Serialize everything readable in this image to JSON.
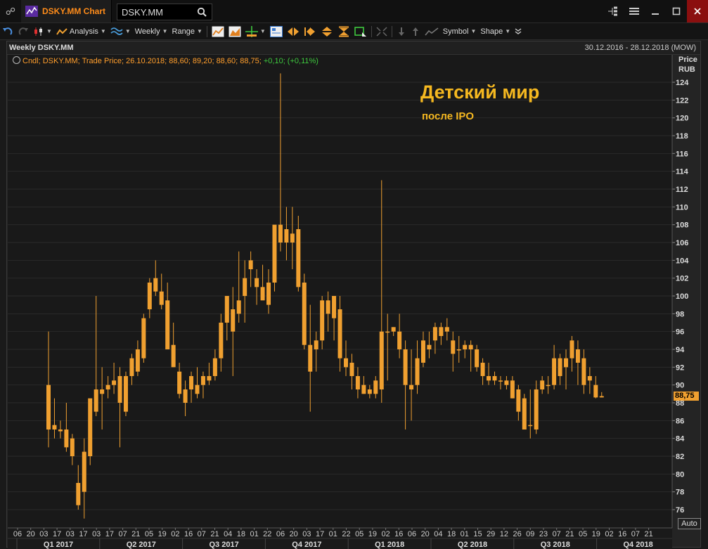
{
  "app": {
    "title": "DSKY.MM Chart",
    "symbol_value": "DSKY.MM"
  },
  "toolbar": {
    "analysis_label": "Analysis",
    "period_label": "Weekly",
    "range_label": "Range",
    "symbol_label": "Symbol",
    "shape_label": "Shape"
  },
  "chart_header": {
    "name": "Weekly DSKY.MM",
    "date_range": "30.12.2016 - 28.12.2018 (MOW)"
  },
  "legend": {
    "text": "Cndl; DSKY.MM; Trade Price; 26.10.2018; 88,60; 89,20; 88,60; 88,75;",
    "change": "+0,10; (+0,11%)"
  },
  "annotation": {
    "title": "Детский мир",
    "subtitle": "после IPO"
  },
  "price_axis": {
    "title_line1": "Price",
    "title_line2": "RUB",
    "last_price": "88,75",
    "auto_label": "Auto"
  },
  "colors": {
    "candle": "#f0a030",
    "accent": "#ff8c1a",
    "annotation": "#f5b820",
    "change_positive": "#3ec93e"
  },
  "chart_data": {
    "type": "candlestick",
    "period": "weekly",
    "ylim": [
      74,
      126
    ],
    "y_ticks": [
      76,
      78,
      80,
      82,
      84,
      86,
      88,
      90,
      92,
      94,
      96,
      98,
      100,
      102,
      104,
      106,
      108,
      110,
      112,
      114,
      116,
      118,
      120,
      122,
      124
    ],
    "x_day_labels": [
      "06",
      "20",
      "03",
      "17",
      "03",
      "17",
      "03",
      "17",
      "07",
      "21",
      "05",
      "19",
      "02",
      "16",
      "07",
      "21",
      "04",
      "18",
      "01",
      "22",
      "06",
      "20",
      "03",
      "17",
      "01",
      "22",
      "05",
      "19",
      "02",
      "16",
      "06",
      "20",
      "04",
      "18",
      "01",
      "15",
      "29",
      "12",
      "26",
      "09",
      "23",
      "07",
      "21",
      "05",
      "19",
      "02",
      "16",
      "07",
      "21"
    ],
    "quarter_labels": [
      "Q1 2017",
      "Q2 2017",
      "Q3 2017",
      "Q4 2017",
      "Q1 2018",
      "Q2 2018",
      "Q3 2018",
      "Q4 2018"
    ],
    "candles": [
      {
        "o": 85.0,
        "h": 96.0,
        "l": 83.0,
        "c": 90.0
      },
      {
        "o": 85.0,
        "h": 88.5,
        "l": 84.0,
        "c": 85.5
      },
      {
        "o": 85.0,
        "h": 86.0,
        "l": 84.0,
        "c": 84.8
      },
      {
        "o": 83.0,
        "h": 88.0,
        "l": 82.5,
        "c": 85.0
      },
      {
        "o": 84.0,
        "h": 84.5,
        "l": 81.0,
        "c": 82.0
      },
      {
        "o": 79.0,
        "h": 81.0,
        "l": 76.0,
        "c": 76.5
      },
      {
        "o": 78.0,
        "h": 84.0,
        "l": 75.0,
        "c": 82.5
      },
      {
        "o": 82.0,
        "h": 85.0,
        "l": 81.0,
        "c": 88.5
      },
      {
        "o": 87.0,
        "h": 100.0,
        "l": 86.5,
        "c": 89.5
      },
      {
        "o": 89.0,
        "h": 92.0,
        "l": 85.0,
        "c": 89.5
      },
      {
        "o": 89.5,
        "h": 91.0,
        "l": 88.5,
        "c": 90.0
      },
      {
        "o": 90.0,
        "h": 92.5,
        "l": 89.0,
        "c": 90.5
      },
      {
        "o": 91.0,
        "h": 92.0,
        "l": 83.0,
        "c": 88.0
      },
      {
        "o": 87.0,
        "h": 91.5,
        "l": 86.5,
        "c": 91.0
      },
      {
        "o": 91.0,
        "h": 93.5,
        "l": 90.0,
        "c": 93.0
      },
      {
        "o": 94.0,
        "h": 95.0,
        "l": 91.0,
        "c": 91.5
      },
      {
        "o": 93.0,
        "h": 98.0,
        "l": 92.5,
        "c": 97.5
      },
      {
        "o": 98.5,
        "h": 102.0,
        "l": 97.5,
        "c": 101.5
      },
      {
        "o": 102.0,
        "h": 104.0,
        "l": 100.0,
        "c": 100.5
      },
      {
        "o": 100.5,
        "h": 102.5,
        "l": 98.5,
        "c": 99.0
      },
      {
        "o": 99.5,
        "h": 101.5,
        "l": 97.0,
        "c": 94.0
      },
      {
        "o": 94.5,
        "h": 97.0,
        "l": 92.0,
        "c": 92.0
      },
      {
        "o": 91.5,
        "h": 92.5,
        "l": 88.5,
        "c": 89.0
      },
      {
        "o": 89.5,
        "h": 90.5,
        "l": 86.5,
        "c": 88.0
      },
      {
        "o": 89.5,
        "h": 91.5,
        "l": 88.0,
        "c": 91.0
      },
      {
        "o": 89.0,
        "h": 92.0,
        "l": 88.5,
        "c": 90.0
      },
      {
        "o": 90.0,
        "h": 91.5,
        "l": 88.5,
        "c": 91.0
      },
      {
        "o": 90.5,
        "h": 92.5,
        "l": 90.0,
        "c": 91.0
      },
      {
        "o": 91.0,
        "h": 94.0,
        "l": 90.5,
        "c": 93.0
      },
      {
        "o": 93.0,
        "h": 98.0,
        "l": 91.5,
        "c": 97.0
      },
      {
        "o": 97.0,
        "h": 100.0,
        "l": 95.0,
        "c": 100.0
      },
      {
        "o": 96.0,
        "h": 101.0,
        "l": 91.0,
        "c": 98.5
      },
      {
        "o": 98.0,
        "h": 105.0,
        "l": 97.0,
        "c": 99.5
      },
      {
        "o": 100.0,
        "h": 104.0,
        "l": 97.0,
        "c": 102.0
      },
      {
        "o": 103.0,
        "h": 105.0,
        "l": 101.0,
        "c": 104.0
      },
      {
        "o": 102.0,
        "h": 103.0,
        "l": 99.0,
        "c": 101.0
      },
      {
        "o": 101.0,
        "h": 103.5,
        "l": 100.0,
        "c": 99.5
      },
      {
        "o": 101.5,
        "h": 103.0,
        "l": 98.0,
        "c": 99.0
      },
      {
        "o": 101.5,
        "h": 103.0,
        "l": 100.5,
        "c": 108.0
      },
      {
        "o": 108.0,
        "h": 125.0,
        "l": 105.0,
        "c": 106.0
      },
      {
        "o": 106.0,
        "h": 110.0,
        "l": 104.0,
        "c": 107.5
      },
      {
        "o": 107.0,
        "h": 110.0,
        "l": 103.0,
        "c": 106.0
      },
      {
        "o": 107.5,
        "h": 109.0,
        "l": 100.5,
        "c": 101.0
      },
      {
        "o": 101.5,
        "h": 102.5,
        "l": 94.0,
        "c": 94.5
      },
      {
        "o": 94.5,
        "h": 99.0,
        "l": 87.0,
        "c": 91.5
      },
      {
        "o": 94.0,
        "h": 96.0,
        "l": 91.5,
        "c": 95.0
      },
      {
        "o": 95.0,
        "h": 100.0,
        "l": 94.0,
        "c": 99.5
      },
      {
        "o": 99.5,
        "h": 100.5,
        "l": 96.0,
        "c": 98.0
      },
      {
        "o": 97.5,
        "h": 100.0,
        "l": 95.0,
        "c": 100.0
      },
      {
        "o": 98.5,
        "h": 100.0,
        "l": 91.5,
        "c": 93.0
      },
      {
        "o": 93.0,
        "h": 95.0,
        "l": 91.0,
        "c": 92.0
      },
      {
        "o": 92.5,
        "h": 93.5,
        "l": 89.5,
        "c": 91.0
      },
      {
        "o": 91.0,
        "h": 92.0,
        "l": 88.5,
        "c": 89.5
      },
      {
        "o": 90.0,
        "h": 91.0,
        "l": 89.0,
        "c": 89.0
      },
      {
        "o": 89.5,
        "h": 90.0,
        "l": 88.5,
        "c": 89.0
      },
      {
        "o": 89.0,
        "h": 91.0,
        "l": 88.5,
        "c": 90.5
      },
      {
        "o": 89.5,
        "h": 113.0,
        "l": 88.0,
        "c": 96.0
      },
      {
        "o": 96.0,
        "h": 98.0,
        "l": 90.5,
        "c": 96.0
      },
      {
        "o": 96.0,
        "h": 96.5,
        "l": 95.5,
        "c": 96.5
      },
      {
        "o": 96.0,
        "h": 98.0,
        "l": 93.0,
        "c": 94.0
      },
      {
        "o": 94.0,
        "h": 95.0,
        "l": 85.0,
        "c": 90.0
      },
      {
        "o": 90.0,
        "h": 94.0,
        "l": 86.0,
        "c": 89.5
      },
      {
        "o": 90.0,
        "h": 95.0,
        "l": 89.0,
        "c": 93.0
      },
      {
        "o": 92.5,
        "h": 96.0,
        "l": 92.0,
        "c": 95.0
      },
      {
        "o": 94.0,
        "h": 96.0,
        "l": 93.0,
        "c": 94.5
      },
      {
        "o": 95.0,
        "h": 97.0,
        "l": 93.5,
        "c": 96.5
      },
      {
        "o": 95.5,
        "h": 97.0,
        "l": 94.5,
        "c": 96.5
      },
      {
        "o": 96.0,
        "h": 97.5,
        "l": 95.0,
        "c": 96.5
      },
      {
        "o": 95.0,
        "h": 96.0,
        "l": 91.5,
        "c": 93.5
      },
      {
        "o": 94.0,
        "h": 95.5,
        "l": 92.5,
        "c": 94.0
      },
      {
        "o": 94.0,
        "h": 95.0,
        "l": 93.0,
        "c": 94.5
      },
      {
        "o": 94.5,
        "h": 95.0,
        "l": 91.5,
        "c": 94.0
      },
      {
        "o": 94.0,
        "h": 94.5,
        "l": 91.5,
        "c": 92.0
      },
      {
        "o": 92.5,
        "h": 93.0,
        "l": 90.0,
        "c": 91.0
      },
      {
        "o": 91.0,
        "h": 92.5,
        "l": 90.0,
        "c": 90.5
      },
      {
        "o": 91.0,
        "h": 91.5,
        "l": 90.0,
        "c": 90.5
      },
      {
        "o": 90.5,
        "h": 91.0,
        "l": 89.5,
        "c": 90.5
      },
      {
        "o": 90.5,
        "h": 91.0,
        "l": 89.5,
        "c": 90.0
      },
      {
        "o": 90.5,
        "h": 91.0,
        "l": 88.5,
        "c": 88.5
      },
      {
        "o": 89.5,
        "h": 90.0,
        "l": 86.0,
        "c": 87.0
      },
      {
        "o": 88.5,
        "h": 89.0,
        "l": 85.0,
        "c": 85.0
      },
      {
        "o": 85.5,
        "h": 89.5,
        "l": 84.0,
        "c": 85.5
      },
      {
        "o": 85.0,
        "h": 90.5,
        "l": 84.5,
        "c": 89.5
      },
      {
        "o": 89.5,
        "h": 91.0,
        "l": 89.0,
        "c": 90.5
      },
      {
        "o": 90.0,
        "h": 91.0,
        "l": 89.0,
        "c": 90.0
      },
      {
        "o": 90.0,
        "h": 94.5,
        "l": 89.5,
        "c": 93.0
      },
      {
        "o": 91.0,
        "h": 93.5,
        "l": 90.0,
        "c": 93.0
      },
      {
        "o": 93.0,
        "h": 94.0,
        "l": 89.5,
        "c": 92.0
      },
      {
        "o": 93.0,
        "h": 95.5,
        "l": 91.5,
        "c": 95.0
      },
      {
        "o": 94.0,
        "h": 95.0,
        "l": 90.0,
        "c": 92.5
      },
      {
        "o": 93.0,
        "h": 94.0,
        "l": 89.0,
        "c": 90.0
      },
      {
        "o": 91.0,
        "h": 92.0,
        "l": 89.0,
        "c": 90.5
      },
      {
        "o": 90.0,
        "h": 91.0,
        "l": 88.5,
        "c": 88.6
      },
      {
        "o": 88.6,
        "h": 89.2,
        "l": 88.6,
        "c": 88.75
      }
    ]
  }
}
